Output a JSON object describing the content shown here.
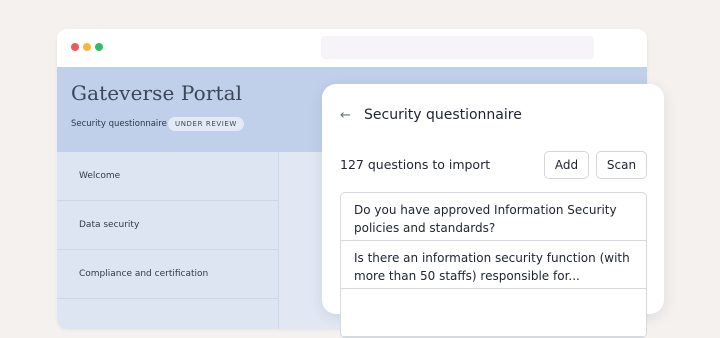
{
  "portal": {
    "title": "Gateverse Portal",
    "subtitle": "Security questionnaire",
    "badge": "UNDER REVIEW"
  },
  "sidebar": {
    "items": [
      {
        "label": "Welcome"
      },
      {
        "label": "Data security"
      },
      {
        "label": "Compliance and certification"
      }
    ]
  },
  "panel": {
    "back_icon": "arrow-left-icon",
    "title": "Security questionnaire",
    "count_text": "127 questions to import",
    "add_label": "Add",
    "scan_label": "Scan",
    "questions": [
      {
        "text": "Do you have approved Information Security policies and standards?"
      },
      {
        "text": "Is there an information security function (with more than 50 staffs) responsible for..."
      }
    ]
  },
  "colors": {
    "page_bg": "#f4f1ef",
    "header_bg": "#c0d0ea",
    "sidebar_bg": "#dde5f3",
    "window_dot_red": "#f0595b",
    "window_dot_yellow": "#f5b83a",
    "window_dot_green": "#2ebf62"
  }
}
